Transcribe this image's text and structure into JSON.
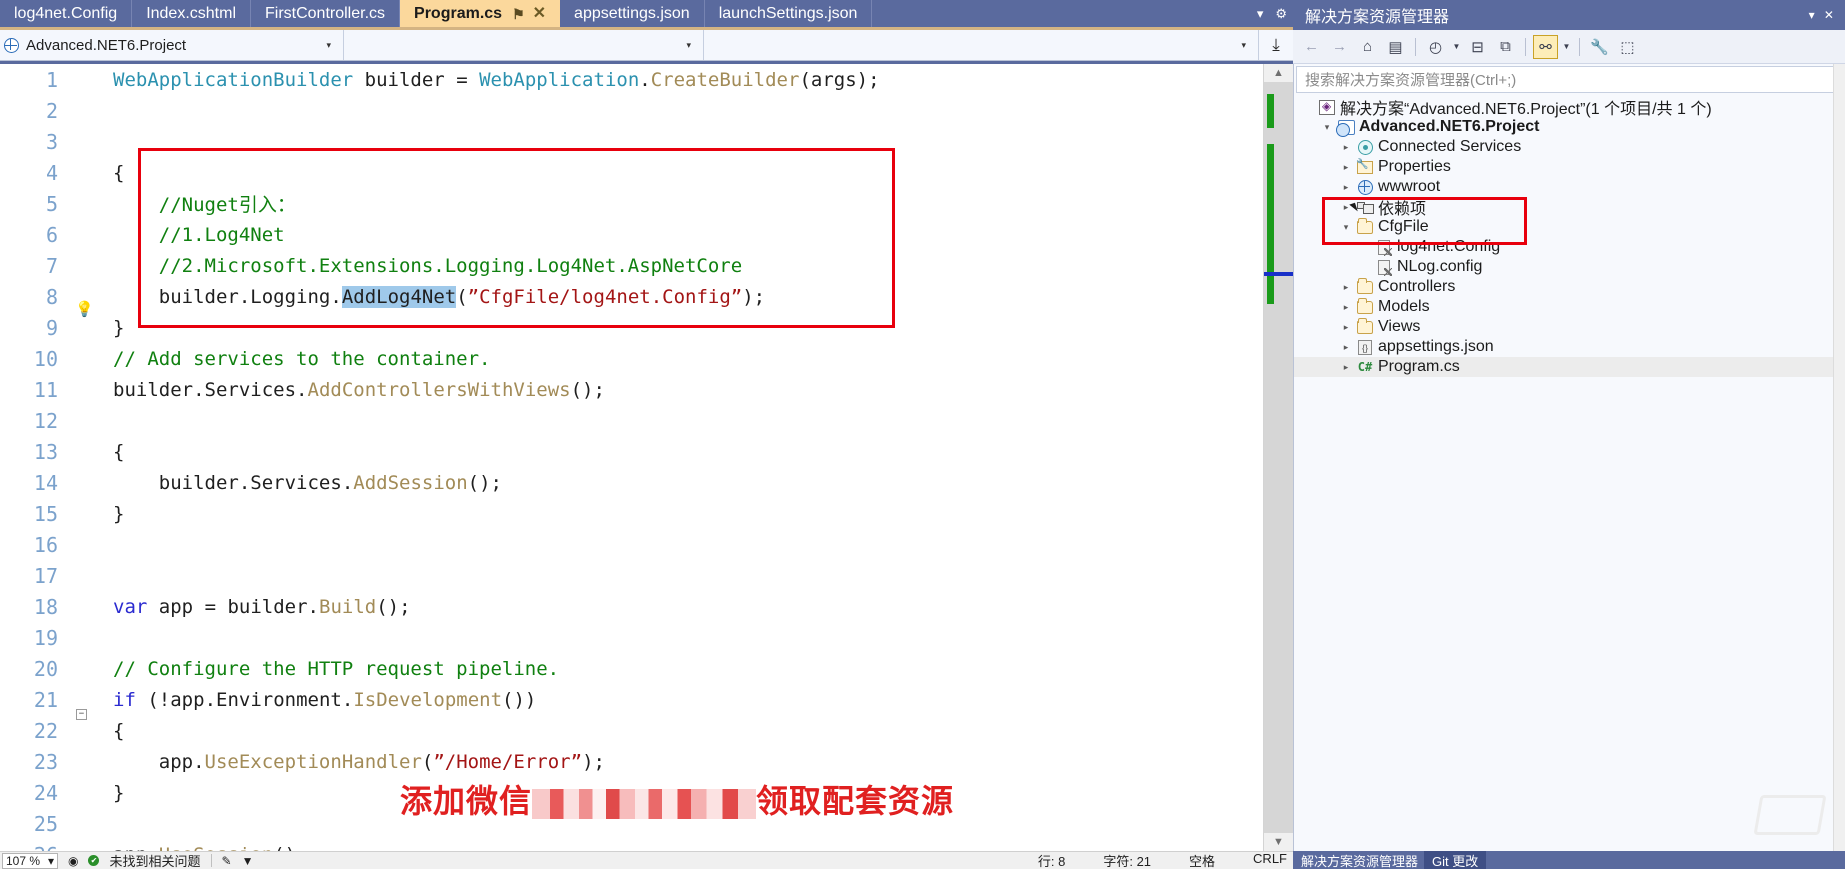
{
  "editor_tabs": [
    {
      "label": "log4net.Config",
      "active": false
    },
    {
      "label": "Index.cshtml",
      "active": false
    },
    {
      "label": "FirstController.cs",
      "active": false
    },
    {
      "label": "Program.cs",
      "active": true
    },
    {
      "label": "appsettings.json",
      "active": false
    },
    {
      "label": "launchSettings.json",
      "active": false
    }
  ],
  "tabstrip_controls": {
    "pin_glyph": "⚑",
    "close_glyph": "✕",
    "overflow_glyph": "▾",
    "settings_glyph": "⚙"
  },
  "navbar": {
    "project_combo": "Advanced.NET6.Project",
    "type_combo": "",
    "member_combo": "",
    "arrow_glyph": "▾",
    "split_glyph": "⤓"
  },
  "code": {
    "lines": [
      {
        "n": "1",
        "changed": true,
        "glyph": "",
        "text_html": "<span class=\"t-type\">WebApplicationBuilder</span> <span class=\"t-plain\">builder</span> <span class=\"t-punct\">=</span> <span class=\"t-type\">WebApplication</span><span class=\"t-punct\">.</span><span class=\"t-method\">CreateBuilder</span><span class=\"t-punct\">(</span><span class=\"t-plain\">args</span><span class=\"t-punct\">);</span>",
        "plain": "WebApplicationBuilder builder = WebApplication.CreateBuilder(args);"
      },
      {
        "n": "2",
        "changed": true,
        "glyph": "",
        "text_html": "",
        "plain": ""
      },
      {
        "n": "3",
        "changed": false,
        "glyph": "",
        "text_html": "",
        "plain": ""
      },
      {
        "n": "4",
        "changed": true,
        "glyph": "",
        "text_html": "<span class=\"t-punct\">{</span>",
        "plain": "{"
      },
      {
        "n": "5",
        "changed": true,
        "glyph": "",
        "text_html": "    <span class=\"t-comment\">//Nuget引入：</span>",
        "plain": "    //Nuget引入："
      },
      {
        "n": "6",
        "changed": true,
        "glyph": "",
        "text_html": "    <span class=\"t-comment\">//1.Log4Net</span>",
        "plain": "    //1.Log4Net"
      },
      {
        "n": "7",
        "changed": true,
        "glyph": "",
        "text_html": "    <span class=\"t-comment\">//2.Microsoft.Extensions.Logging.Log4Net.AspNetCore</span>",
        "plain": "    //2.Microsoft.Extensions.Logging.Log4Net.AspNetCore"
      },
      {
        "n": "8",
        "changed": true,
        "glyph": "bulb",
        "text_html": "    <span class=\"t-plain\">builder</span><span class=\"t-punct\">.</span><span class=\"t-plain\">Logging</span><span class=\"t-punct\">.</span><span class=\"t-sel\">AddLog4Net</span><span class=\"t-punct\">(</span><span class=\"t-string\">”CfgFile/log4net.Config”</span><span class=\"t-punct\">);</span>",
        "plain": "    builder.Logging.AddLog4Net(”CfgFile/log4net.Config”);"
      },
      {
        "n": "9",
        "changed": true,
        "glyph": "",
        "text_html": "<span class=\"t-punct\">}</span>",
        "plain": "}"
      },
      {
        "n": "10",
        "changed": false,
        "glyph": "",
        "text_html": "<span class=\"t-comment\">// Add services to the container.</span>",
        "plain": "// Add services to the container."
      },
      {
        "n": "11",
        "changed": false,
        "glyph": "",
        "text_html": "<span class=\"t-plain\">builder</span><span class=\"t-punct\">.</span><span class=\"t-plain\">Services</span><span class=\"t-punct\">.</span><span class=\"t-method\">AddControllersWithViews</span><span class=\"t-punct\">();</span>",
        "plain": "builder.Services.AddControllersWithViews();"
      },
      {
        "n": "12",
        "changed": false,
        "glyph": "",
        "text_html": "",
        "plain": ""
      },
      {
        "n": "13",
        "changed": false,
        "glyph": "",
        "text_html": "<span class=\"t-punct\">{</span>",
        "plain": "{"
      },
      {
        "n": "14",
        "changed": false,
        "glyph": "",
        "text_html": "    <span class=\"t-plain\">builder</span><span class=\"t-punct\">.</span><span class=\"t-plain\">Services</span><span class=\"t-punct\">.</span><span class=\"t-method\">AddSession</span><span class=\"t-punct\">();</span>",
        "plain": "    builder.Services.AddSession();"
      },
      {
        "n": "15",
        "changed": false,
        "glyph": "",
        "text_html": "<span class=\"t-punct\">}</span>",
        "plain": "}"
      },
      {
        "n": "16",
        "changed": false,
        "glyph": "",
        "text_html": "",
        "plain": ""
      },
      {
        "n": "17",
        "changed": false,
        "glyph": "",
        "text_html": "",
        "plain": ""
      },
      {
        "n": "18",
        "changed": false,
        "glyph": "",
        "text_html": "<span class=\"t-kw\">var</span> <span class=\"t-plain\">app</span> <span class=\"t-punct\">=</span> <span class=\"t-plain\">builder</span><span class=\"t-punct\">.</span><span class=\"t-method\">Build</span><span class=\"t-punct\">();</span>",
        "plain": "var app = builder.Build();"
      },
      {
        "n": "19",
        "changed": false,
        "glyph": "",
        "text_html": "",
        "plain": ""
      },
      {
        "n": "20",
        "changed": false,
        "glyph": "",
        "text_html": "<span class=\"t-comment\">// Configure the HTTP request pipeline.</span>",
        "plain": "// Configure the HTTP request pipeline."
      },
      {
        "n": "21",
        "changed": false,
        "glyph": "collapse",
        "text_html": "<span class=\"t-kw\">if</span> <span class=\"t-punct\">(!</span><span class=\"t-plain\">app</span><span class=\"t-punct\">.</span><span class=\"t-plain\">Environment</span><span class=\"t-punct\">.</span><span class=\"t-method\">IsDevelopment</span><span class=\"t-punct\">())</span>",
        "plain": "if (!app.Environment.IsDevelopment())"
      },
      {
        "n": "22",
        "changed": false,
        "glyph": "guide",
        "text_html": "<span class=\"t-punct\">{</span>",
        "plain": "{"
      },
      {
        "n": "23",
        "changed": false,
        "glyph": "guide",
        "text_html": "    <span class=\"t-plain\">app</span><span class=\"t-punct\">.</span><span class=\"t-method\">UseExceptionHandler</span><span class=\"t-punct\">(</span><span class=\"t-string\">”/Home/Error”</span><span class=\"t-punct\">);</span>",
        "plain": "    app.UseExceptionHandler(”/Home/Error”);"
      },
      {
        "n": "24",
        "changed": false,
        "glyph": "guide",
        "text_html": "<span class=\"t-punct\">}</span>",
        "plain": "}"
      },
      {
        "n": "25",
        "changed": false,
        "glyph": "",
        "text_html": "",
        "plain": ""
      },
      {
        "n": "26",
        "changed": false,
        "glyph": "",
        "text_html": "<span class=\"t-plain\">app</span><span class=\"t-punct\">.</span><span class=\"t-method\">UseSession</span><span class=\"t-punct\">();</span>",
        "plain": "app.UseSession();"
      }
    ],
    "watermark_prefix": "添加微信",
    "watermark_suffix": "领取配套资源",
    "highlight_color": "#e8000d",
    "selection_color": "#9fc9ea"
  },
  "editor_scrollbar": {
    "up_glyph": "▲",
    "down_glyph": "▼"
  },
  "solution_explorer": {
    "title": "解决方案资源管理器",
    "title_controls": "▾ ✕",
    "toolbar": [
      {
        "name": "back-icon",
        "glyph": "←"
      },
      {
        "name": "forward-icon",
        "glyph": "→"
      },
      {
        "name": "home-icon",
        "glyph": "⌂"
      },
      {
        "name": "vs-solution-icon",
        "glyph": "▤"
      },
      {
        "name": "pending-changes-icon",
        "glyph": "◴"
      },
      {
        "name": "collapse-all-icon",
        "glyph": "⊟"
      },
      {
        "name": "show-all-files-icon",
        "glyph": "⧉"
      },
      {
        "name": "properties-icon",
        "glyph": "ὒ7"
      },
      {
        "name": "preview-icon",
        "glyph": "⬚"
      }
    ],
    "search_placeholder": "搜索解决方案资源管理器(Ctrl+;)",
    "tree": [
      {
        "label": "解决方案“Advanced.NET6.Project”(1 个项目/共 1 个)",
        "indent": 0,
        "twisty": "",
        "icon": "sln",
        "bold": false,
        "selected": false
      },
      {
        "label": "Advanced.NET6.Project",
        "indent": 1,
        "twisty": "▾",
        "icon": "proj",
        "bold": true,
        "selected": false
      },
      {
        "label": "Connected Services",
        "indent": 2,
        "twisty": "▸",
        "icon": "svc",
        "bold": false,
        "selected": false
      },
      {
        "label": "Properties",
        "indent": 2,
        "twisty": "▸",
        "icon": "props",
        "bold": false,
        "selected": false
      },
      {
        "label": "wwwroot",
        "indent": 2,
        "twisty": "▸",
        "icon": "globe",
        "bold": false,
        "selected": false
      },
      {
        "label": "依赖项",
        "indent": 2,
        "twisty": "▸",
        "icon": "dep",
        "bold": false,
        "selected": false
      },
      {
        "label": "CfgFile",
        "indent": 2,
        "twisty": "▾",
        "icon": "folder",
        "bold": false,
        "selected": false
      },
      {
        "label": "log4net.Config",
        "indent": 3,
        "twisty": "",
        "icon": "doc",
        "bold": false,
        "selected": false
      },
      {
        "label": "NLog.config",
        "indent": 3,
        "twisty": "",
        "icon": "doc",
        "bold": false,
        "selected": false
      },
      {
        "label": "Controllers",
        "indent": 2,
        "twisty": "▸",
        "icon": "folder",
        "bold": false,
        "selected": false
      },
      {
        "label": "Models",
        "indent": 2,
        "twisty": "▸",
        "icon": "folder",
        "bold": false,
        "selected": false
      },
      {
        "label": "Views",
        "indent": 2,
        "twisty": "▸",
        "icon": "folder",
        "bold": false,
        "selected": false
      },
      {
        "label": "appsettings.json",
        "indent": 2,
        "twisty": "▸",
        "icon": "json",
        "bold": false,
        "selected": false
      },
      {
        "label": "Program.cs",
        "indent": 2,
        "twisty": "▸",
        "icon": "cs",
        "bold": false,
        "selected": true
      }
    ]
  },
  "status_bar": {
    "zoom": "107 %",
    "zoom_arrow": "▾",
    "error_badge": "✔",
    "error_text": "未找到相关问题",
    "pen_icon": "✎",
    "line_label": "行: 8",
    "col_label": "字符: 21",
    "indent_label": "空格",
    "eol_label": "CRLF",
    "se_tab": "解决方案资源管理器",
    "git_tab": "Git 更改"
  },
  "colors": {
    "chrome_blue": "#5a6a9e",
    "active_tab": "#fbd89c",
    "accent_gold": "#d4b483",
    "highlight_red": "#e8000d",
    "change_green": "#1a9b1a"
  }
}
